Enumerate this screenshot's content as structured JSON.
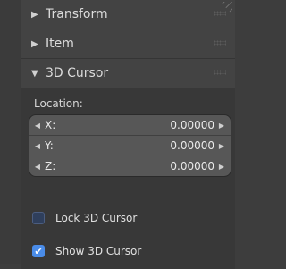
{
  "panels": [
    {
      "label": "Transform",
      "expanded": false
    },
    {
      "label": "Item",
      "expanded": false
    },
    {
      "label": "3D Cursor",
      "expanded": true
    }
  ],
  "cursor": {
    "section_label": "Location:",
    "fields": [
      {
        "name": "X:",
        "value": "0.00000"
      },
      {
        "name": "Y:",
        "value": "0.00000"
      },
      {
        "name": "Z:",
        "value": "0.00000"
      }
    ],
    "lock_label": "Lock 3D Cursor",
    "lock_checked": false,
    "show_label": "Show 3D Cursor",
    "show_checked": true
  },
  "icons": {
    "collapsed": "triangle-right-icon",
    "expanded": "triangle-down-icon",
    "decrement": "arrow-left-icon",
    "increment": "arrow-right-icon",
    "check": "checkmark-icon"
  },
  "colors": {
    "background": "#3d3d3d",
    "header": "#434343",
    "field": "#575757",
    "checkbox_on": "#4a8ce8"
  }
}
